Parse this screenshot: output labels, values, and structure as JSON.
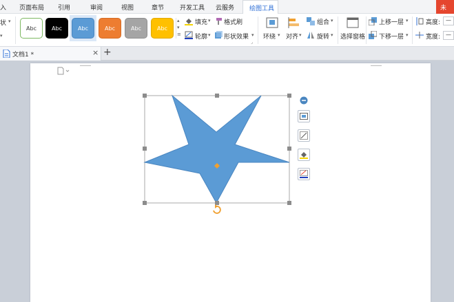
{
  "menubar": {
    "items": [
      "入",
      "页面布局",
      "引用",
      "审阅",
      "视图",
      "章节",
      "开发工具",
      "云服务",
      "绘图工具"
    ],
    "active": "绘图工具",
    "login": "未"
  },
  "ribbon": {
    "left_fragment": "状",
    "shape_styles": [
      {
        "label": "Abc",
        "fill": "#ffffff",
        "border": "#7cb860",
        "text": "#333333"
      },
      {
        "label": "Abc",
        "fill": "#000000",
        "border": "#000000",
        "text": "#ffffff"
      },
      {
        "label": "Abc",
        "fill": "#5b9bd5",
        "border": "#4a86c0",
        "text": "#ffffff"
      },
      {
        "label": "Abc",
        "fill": "#ed7d31",
        "border": "#d46b24",
        "text": "#ffffff"
      },
      {
        "label": "Abc",
        "fill": "#a5a5a5",
        "border": "#8e8e8e",
        "text": "#ffffff"
      },
      {
        "label": "Abc",
        "fill": "#ffc000",
        "border": "#e0a800",
        "text": "#ffffff"
      }
    ],
    "fill_label": "填充",
    "outline_label": "轮廓",
    "format_painter_label": "格式刷",
    "shape_effects_label": "形状效果",
    "wrap_label": "环绕",
    "align_label": "对齐",
    "group_label": "组合",
    "rotate_label": "旋转",
    "selection_pane_label": "选择窗格",
    "bring_forward_label": "上移一层",
    "send_backward_label": "下移一层",
    "height_label": "高度:",
    "width_label": "宽度:",
    "height_value": "—",
    "width_value": "—"
  },
  "tabs": {
    "doc_title": "文档1 *",
    "close_symbol": "×",
    "new_symbol": "+"
  },
  "colors": {
    "star_fill": "#5b9bd5",
    "star_stroke": "#4a86c0",
    "handle": "#8c8c8c",
    "accent": "#2f6fd6",
    "rotate": "#f0a030"
  }
}
